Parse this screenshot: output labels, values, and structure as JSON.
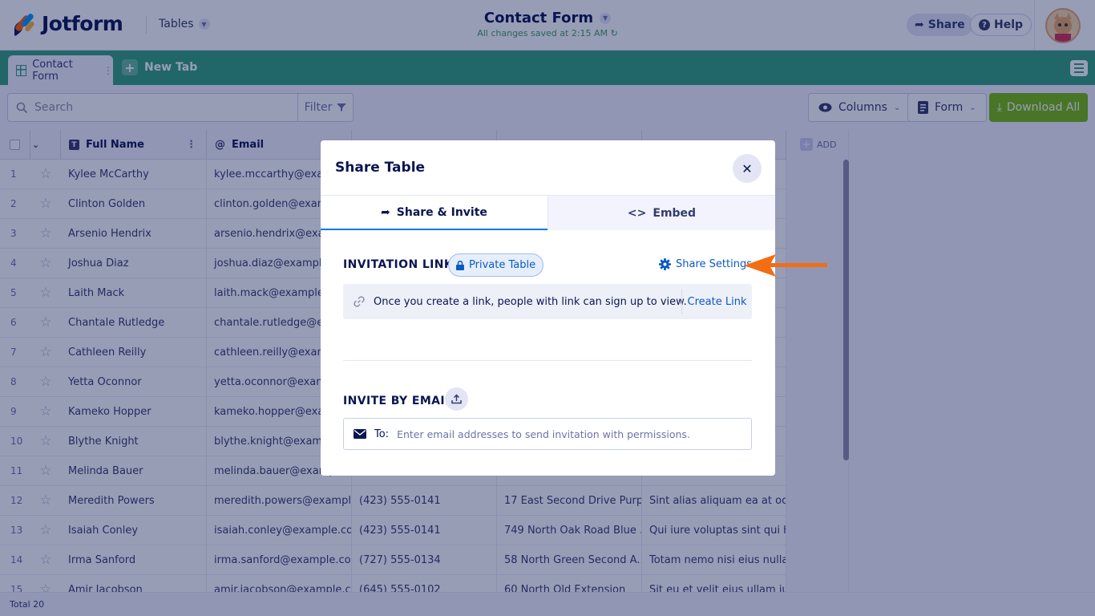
{
  "header": {
    "logo_text": "Jotform",
    "tables_label": "Tables",
    "form_title": "Contact Form",
    "save_status": "All changes saved at 2:15 AM",
    "share_label": "Share",
    "help_label": "Help"
  },
  "tabs": {
    "active_tab": "Contact Form",
    "new_tab_label": "New Tab"
  },
  "toolbar": {
    "search_placeholder": "Search",
    "filter_label": "Filter",
    "columns_label": "Columns",
    "form_label": "Form",
    "download_label": "Download All"
  },
  "table": {
    "columns": [
      "Full Name",
      "Email"
    ],
    "add_label": "ADD",
    "rows": [
      {
        "num": "1",
        "name": "Kylee McCarthy",
        "email": "kylee.mccarthy@exampl",
        "phone": "",
        "address": "",
        "message": ""
      },
      {
        "num": "2",
        "name": "Clinton Golden",
        "email": "clinton.golden@exampl",
        "phone": "",
        "address": "",
        "message": ""
      },
      {
        "num": "3",
        "name": "Arsenio Hendrix",
        "email": "arsenio.hendrix@examp",
        "phone": "",
        "address": "",
        "message": ""
      },
      {
        "num": "4",
        "name": "Joshua Diaz",
        "email": "joshua.diaz@example.co",
        "phone": "",
        "address": "",
        "message": ""
      },
      {
        "num": "5",
        "name": "Laith Mack",
        "email": "laith.mack@example.co",
        "phone": "",
        "address": "",
        "message": ""
      },
      {
        "num": "6",
        "name": "Chantale Rutledge",
        "email": "chantale.rutledge@exar",
        "phone": "",
        "address": "",
        "message": ""
      },
      {
        "num": "7",
        "name": "Cathleen Reilly",
        "email": "cathleen.reilly@example",
        "phone": "",
        "address": "",
        "message": ""
      },
      {
        "num": "8",
        "name": "Yetta Oconnor",
        "email": "yetta.oconnor@example",
        "phone": "",
        "address": "",
        "message": ""
      },
      {
        "num": "9",
        "name": "Kameko Hopper",
        "email": "kameko.hopper@examp",
        "phone": "",
        "address": "",
        "message": ""
      },
      {
        "num": "10",
        "name": "Blythe Knight",
        "email": "blythe.knight@example",
        "phone": "",
        "address": "",
        "message": ""
      },
      {
        "num": "11",
        "name": "Melinda Bauer",
        "email": "melinda.bauer@exampl",
        "phone": "",
        "address": "",
        "message": ""
      },
      {
        "num": "12",
        "name": "Meredith Powers",
        "email": "meredith.powers@exampl...",
        "phone": "(423) 555-0141",
        "address": "17 East Second Drive Purpl...",
        "message": "Sint alias aliquam ea at oc..."
      },
      {
        "num": "13",
        "name": "Isaiah Conley",
        "email": "isaiah.conley@example.com",
        "phone": "(423) 555-0141",
        "address": "749 North Oak Road Blue ...",
        "message": "Qui iure voluptas sint qui h..."
      },
      {
        "num": "14",
        "name": "Irma Sanford",
        "email": "irma.sanford@example.com",
        "phone": "(727) 555-0134",
        "address": "58 North Green Second A...",
        "message": "Totam nemo nisi eius nulla..."
      },
      {
        "num": "15",
        "name": "Amir Jacobson",
        "email": "amir.jacobson@example.c...",
        "phone": "(645) 555-0102",
        "address": "60 North Old Extension",
        "message": "Sit eu et velit eius ullam iu..."
      }
    ]
  },
  "footer": {
    "total": "Total 20"
  },
  "modal": {
    "title": "Share Table",
    "tab_share": "Share & Invite",
    "tab_embed": "Embed",
    "invitation_label": "INVITATION LINK",
    "private_label": "Private Table",
    "share_settings_label": "Share Settings",
    "link_info": "Once you create a link, people with link can sign up to view.",
    "create_link_label": "Create Link",
    "invite_email_label": "INVITE BY EMAIL",
    "to_label": "To:",
    "email_placeholder": "Enter email addresses to send invitation with permissions."
  },
  "colors": {
    "tabbar": "#32a17a",
    "download": "#78bb07",
    "accent_blue": "#0075e3",
    "arrow": "#f36d15"
  }
}
